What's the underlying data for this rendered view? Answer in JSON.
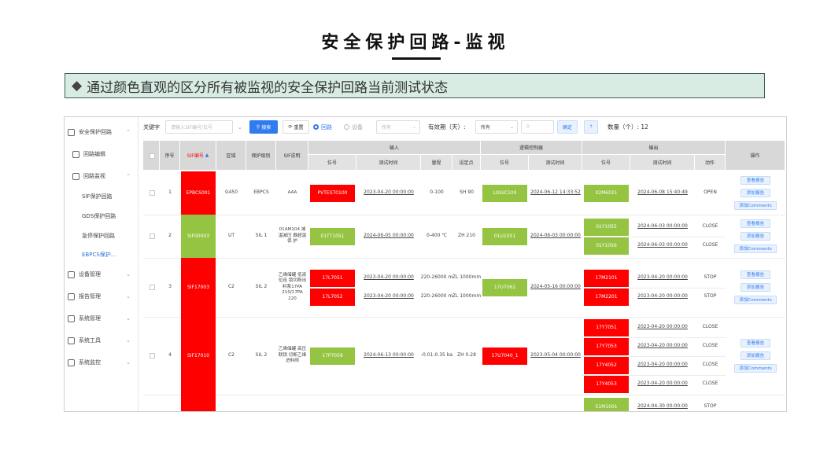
{
  "slide": {
    "title": "安全保护回路-监视",
    "banner": "通过颜色直观的区分所有被监视的安全保护回路当前测试状态"
  },
  "colors": {
    "fail": "#fe0000",
    "pass": "#94c442",
    "accent": "#2f7bf0"
  },
  "sidebar": {
    "items": [
      {
        "label": "安全保护回路",
        "icon": "shield-icon",
        "chev": "⌃",
        "active": false
      },
      {
        "label": "回路编辑",
        "icon": "edit-icon",
        "chev": "",
        "active": false
      },
      {
        "label": "回路监视",
        "icon": "monitor-icon",
        "chev": "⌃",
        "active": false
      },
      {
        "label": "SIF保护回路",
        "icon": "",
        "chev": "",
        "active": false
      },
      {
        "label": "GDS保护回路",
        "icon": "",
        "chev": "",
        "active": false
      },
      {
        "label": "急停保护回路",
        "icon": "",
        "chev": "",
        "active": false
      },
      {
        "label": "EBPCS保护...",
        "icon": "",
        "chev": "",
        "active": true
      },
      {
        "label": "设备管理",
        "icon": "device-icon",
        "chev": "⌄",
        "active": false
      },
      {
        "label": "报告管理",
        "icon": "report-icon",
        "chev": "⌄",
        "active": false
      },
      {
        "label": "系统管理",
        "icon": "gear-icon",
        "chev": "⌄",
        "active": false
      },
      {
        "label": "系统工具",
        "icon": "tool-icon",
        "chev": "⌄",
        "active": false
      },
      {
        "label": "系统监控",
        "icon": "monitor-icon",
        "chev": "⌄",
        "active": false
      }
    ]
  },
  "toolbar": {
    "keyword_label": "关键字",
    "keyword_placeholder": "请输入SIF编号/位号",
    "search": "搜索",
    "reset": "重置",
    "radio_loop": "回路",
    "radio_device": "设备",
    "select_all": "所有",
    "validity_label": "有效期（天）:",
    "validity_select": "所有",
    "validity_value": "0",
    "confirm": "确定",
    "up_icon": "up-arrow-icon",
    "count_label": "数量（个）: 12"
  },
  "table": {
    "headers": {
      "seq": "序号",
      "sif": "SIF编号",
      "area": "区域",
      "level": "保护级别",
      "desc": "SIF说明",
      "input": "输入",
      "logic": "逻辑控制器",
      "output": "输出",
      "op": "操作",
      "tag": "位号",
      "test_time": "测试时间",
      "range": "量程",
      "setpoint": "设定点",
      "action": "动作"
    },
    "rows": [
      {
        "seq": "1",
        "sif": "EPBCS001",
        "sif_status": "fail",
        "area": "G450",
        "level": "EBPCS",
        "desc": "AAA",
        "inputs": [
          {
            "tag": "PVTEST0100",
            "status": "fail",
            "time": "2023-04-20 00:00:00",
            "range": "0-100",
            "setpoint": "SH 90"
          }
        ],
        "logic": {
          "tag": "LOGIC100",
          "status": "pass",
          "time": "2024-06-12 14:33:52"
        },
        "outputs": [
          {
            "tag": "02M6021",
            "status": "pass",
            "time": "2024-06-08 15:40:49",
            "action": "OPEN"
          }
        ],
        "ops": [
          "查看报告",
          "添加报告",
          "添加Comments"
        ]
      },
      {
        "seq": "2",
        "sif": "SIF00003",
        "sif_status": "pass",
        "area": "UT",
        "level": "SIL 1",
        "desc": "01AM104 减温减压 器超温保 护",
        "inputs": [
          {
            "tag": "01TT1051",
            "status": "pass",
            "time": "2024-06-05 00:00:00",
            "range": "0-400 ℃",
            "setpoint": "ZH 210"
          }
        ],
        "logic": {
          "tag": "01U1051",
          "status": "pass",
          "time": "2024-06-03 00:00:00"
        },
        "outputs": [
          {
            "tag": "01Y1055",
            "status": "pass",
            "time": "2024-06-03 00:00:00",
            "action": "CLOSE"
          },
          {
            "tag": "01Y1056",
            "status": "pass",
            "time": "2024-06-03 00:00:00",
            "action": "CLOSE"
          }
        ],
        "ops": [
          "查看报告",
          "添加报告",
          "添加Comments"
        ]
      },
      {
        "seq": "3",
        "sif": "SIF17003",
        "sif_status": "fail",
        "area": "C2",
        "level": "SIL 2",
        "desc": "乙烯储罐 低液位连 锁切断出 料泵17PA 210/17PA 220",
        "inputs": [
          {
            "tag": "17L7051",
            "status": "fail",
            "time": "2023-04-20 00:00:00",
            "range": "220-26000 m",
            "setpoint": "ZL 1000mm"
          },
          {
            "tag": "17L7052",
            "status": "fail",
            "time": "2023-04-20 00:00:00",
            "range": "220-26000 m",
            "setpoint": "ZL 1000mm"
          }
        ],
        "logic": {
          "tag": "17U7062",
          "status": "pass",
          "time": "2024-05-16 00:00:00"
        },
        "outputs": [
          {
            "tag": "17M2101",
            "status": "fail",
            "time": "2023-04-20 00:00:00",
            "action": "STOP"
          },
          {
            "tag": "17M2201",
            "status": "fail",
            "time": "2023-04-20 00:00:00",
            "action": "STOP"
          }
        ],
        "ops": [
          "查看报告",
          "添加报告",
          "添加Comments"
        ]
      },
      {
        "seq": "4",
        "sif": "SIF17010",
        "sif_status": "fail",
        "area": "C2",
        "level": "SIL 2",
        "desc": "乙烯储罐 高压联锁 切断乙烯 进料阀",
        "inputs": [
          {
            "tag": "17P7058",
            "status": "pass",
            "time": "2024-06-13 00:00:00",
            "range": "-0.01-0.35 ba",
            "setpoint": "ZH 0.28"
          }
        ],
        "logic": {
          "tag": "17U7040_1",
          "status": "fail",
          "time": "2023-05-04 00:00:00"
        },
        "outputs": [
          {
            "tag": "17Y7051",
            "status": "fail",
            "time": "2023-04-20 00:00:00",
            "action": "CLOSE"
          },
          {
            "tag": "17Y7053",
            "status": "fail",
            "time": "2023-04-20 00:00:00",
            "action": "CLOSE"
          },
          {
            "tag": "17Y4052",
            "status": "fail",
            "time": "2023-04-20 00:00:00",
            "action": "CLOSE"
          },
          {
            "tag": "17Y4053",
            "status": "fail",
            "time": "2023-04-20 00:00:00",
            "action": "CLOSE"
          }
        ],
        "ops": [
          "查看报告",
          "添加报告",
          "添加Comments"
        ]
      },
      {
        "seq": "",
        "sif": "",
        "sif_status": "fail",
        "area": "",
        "level": "",
        "desc": "",
        "inputs": [],
        "logic": null,
        "outputs": [
          {
            "tag": "51M1001",
            "status": "pass",
            "time": "2024-04-30 00:00:00",
            "action": "STOP"
          }
        ],
        "ops": []
      }
    ]
  }
}
